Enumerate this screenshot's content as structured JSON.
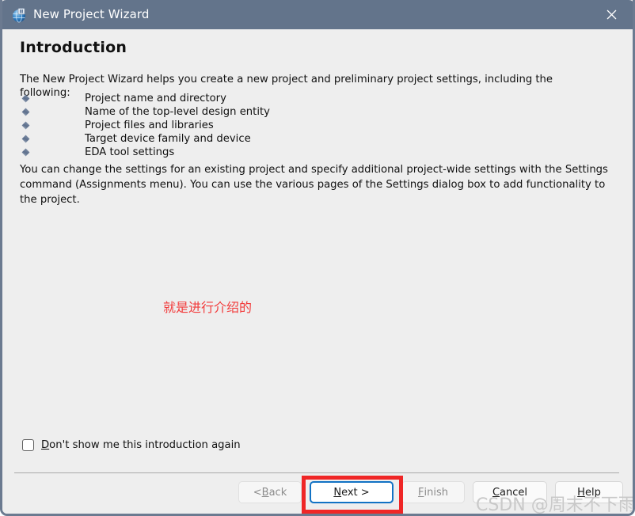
{
  "window": {
    "title": "New Project Wizard",
    "icon": "quartus-globe-icon",
    "close_label": "×",
    "titlebar_color": "#63748b",
    "body_color": "#eeeeee"
  },
  "page": {
    "heading": "Introduction",
    "intro_paragraph": "The New Project Wizard helps you create a new project and preliminary project settings, including the following:",
    "bullets": [
      "Project name and directory",
      "Name of the top-level design entity",
      "Project files and libraries",
      "Target device family and device",
      "EDA tool settings"
    ],
    "settings_paragraph": "You can change the settings for an existing project and specify additional project-wide settings with the Settings command (Assignments menu). You can use the various pages of the Settings dialog box to add functionality to the project."
  },
  "annotation": {
    "note_text": "就是进行介绍的",
    "note_color": "#f23b3b",
    "highlight_color": "#ef2626",
    "highlight_target": "Next >"
  },
  "checkbox": {
    "label_accel": "D",
    "label_rest": "on't show me this introduction again",
    "checked": false
  },
  "footer": {
    "buttons": [
      {
        "name": "back",
        "prefix": "< ",
        "accel": "B",
        "suffix": "ack",
        "enabled": false,
        "focused": false
      },
      {
        "name": "next",
        "prefix": "",
        "accel": "N",
        "suffix": "ext >",
        "enabled": true,
        "focused": true
      },
      {
        "name": "finish",
        "prefix": "",
        "accel": "F",
        "suffix": "inish",
        "enabled": false,
        "focused": false
      },
      {
        "name": "cancel",
        "prefix": "",
        "accel": "C",
        "suffix": "ancel",
        "enabled": true,
        "focused": false
      },
      {
        "name": "help",
        "prefix": "",
        "accel": "H",
        "suffix": "elp",
        "enabled": true,
        "focused": false
      }
    ]
  },
  "watermark": {
    "text": "CSDN @周末不下雨"
  }
}
